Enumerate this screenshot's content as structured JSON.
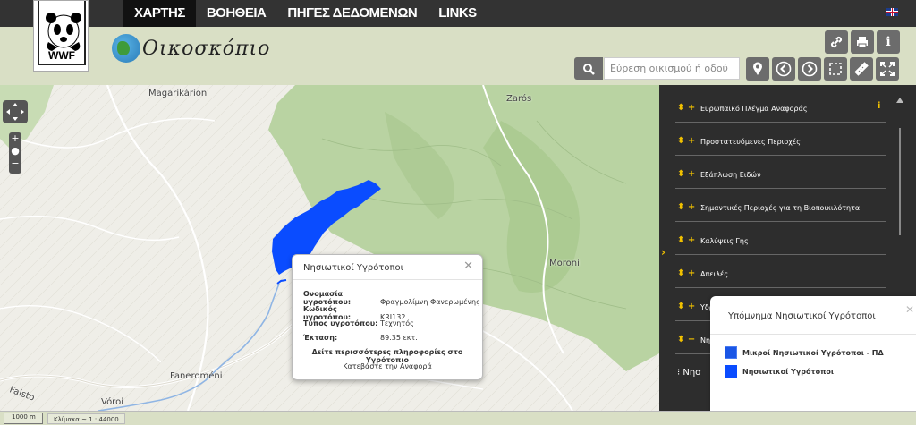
{
  "nav": {
    "items": [
      {
        "label": "ΧΑΡΤΗΣ",
        "active": true
      },
      {
        "label": "ΒΟΗΘΕΙΑ"
      },
      {
        "label": "ΠΗΓΕΣ ΔΕΔΟΜΕΝΩΝ"
      },
      {
        "label": "LINKS"
      }
    ],
    "language_icon": "uk-flag-icon"
  },
  "header": {
    "logo_text": "WWF",
    "brand_name": "Οικοσκόπιο",
    "search_placeholder": "Εύρεση οικισμού ή οδού",
    "buttons": [
      "link-icon",
      "print-icon",
      "info-icon",
      "search-icon",
      "location-pin-icon",
      "back-icon",
      "forward-icon",
      "select-area-icon",
      "measure-ruler-icon",
      "fullscreen-icon"
    ]
  },
  "map": {
    "places": [
      "Magarikárion",
      "Zarós",
      "Moroni",
      "Faneroméni",
      "Vóroi",
      "Faisto"
    ]
  },
  "popup": {
    "title": "Νησιωτικοί Υγρότοποι",
    "close": "✕",
    "rows": [
      {
        "key": "Ονομασία υγροτόπου:",
        "value": "Φραγμολίμνη Φανερωμένης"
      },
      {
        "key": "Κωδικός υγροτόπου:",
        "value": "KRI132"
      },
      {
        "key": "Τύπος υγροτόπου:",
        "value": "Τεχνητός"
      },
      {
        "key": "Έκταση:",
        "value": "89.35 εκτ."
      }
    ],
    "link_more": "Δείτε περισσότερες πληροφορίες στο Υγρότοπιο",
    "link_report": "Κατεβάστε την Αναφορά"
  },
  "panel": {
    "layers": [
      {
        "label": "Ευρωπαϊκό Πλέγμα Αναφοράς",
        "icon": "⬍ +"
      },
      {
        "label": "Προστατευόμενες Περιοχές",
        "icon": "⬍ +"
      },
      {
        "label": "Εξάπλωση Ειδών",
        "icon": "⬍ +"
      },
      {
        "label": "Σημαντικές Περιοχές για τη Βιοποικιλότητα",
        "icon": "⬍ +"
      },
      {
        "label": "Καλύψεις Γης",
        "icon": "⬍ +"
      },
      {
        "label": "Απειλές",
        "icon": "⬍ +"
      },
      {
        "label": "Υδρ",
        "icon": "⬍ +"
      },
      {
        "label": "Νησ",
        "icon": "⬍ −"
      },
      {
        "label": "",
        "icon": "⁝ Νησ"
      }
    ],
    "info": "i"
  },
  "legend": {
    "title": "Υπόμνημα Νησιωτικοί Υγρότοποι",
    "close": "✕",
    "items": [
      {
        "label": "Μικροί Νησιωτικοί Υγρότοποι - ΠΔ",
        "color": "#1a56e6"
      },
      {
        "label": "Νησιωτικοί Υγρότοποι",
        "color": "#0a4cff"
      }
    ]
  },
  "scale": {
    "length": "1000 m",
    "ratio": "Κλίμακα ~ 1 : 44000"
  },
  "colors": {
    "topbar": "#333333",
    "header": "#d9dfc5",
    "accent": "#f0c000",
    "wetland": "#0a4cff",
    "map_green": "#b9d3a2"
  }
}
